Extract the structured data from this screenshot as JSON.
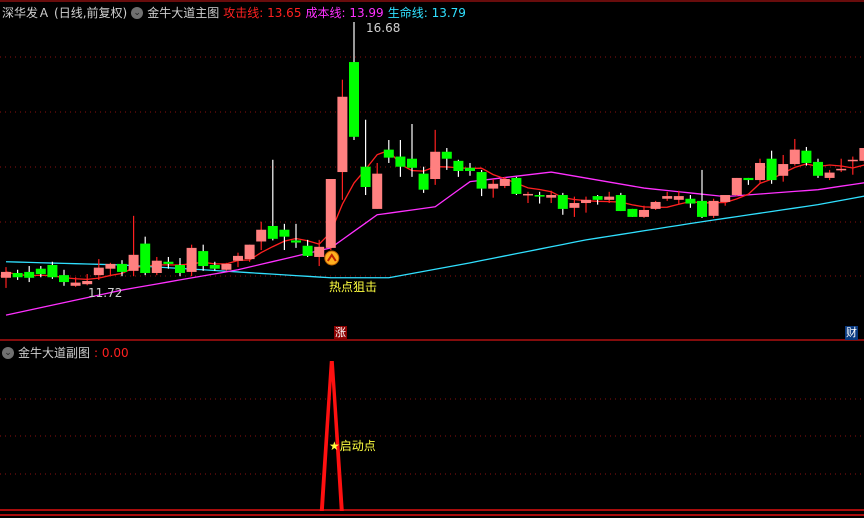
{
  "main_header": {
    "stock": "深华发Ａ",
    "mode": "(日线,前复权)",
    "indicator": "金牛大道主图",
    "attack_label": "攻击线:",
    "attack_value": "13.65",
    "cost_label": "成本线:",
    "cost_value": "13.99",
    "life_label": "生命线:",
    "life_value": "13.79"
  },
  "sub_header": {
    "indicator": "金牛大道副图",
    "value": ": 0.00"
  },
  "annotations": {
    "high_label": "16.68",
    "low_label": "11.72",
    "signal_main": "热点狙击",
    "signal_sub": "启动点",
    "tag_zhang": "涨",
    "tag_cai": "财"
  },
  "colors": {
    "up": "#ff8080",
    "down": "#00ff00",
    "attack": "#ff2020",
    "cost": "#ff30ff",
    "life": "#30e0ff",
    "grid": "#8b1010"
  },
  "chart_data": {
    "type": "candlestick",
    "ylim": [
      11.0,
      16.9
    ],
    "candles": [
      [
        11.89,
        12.09,
        11.7,
        12.0
      ],
      [
        11.98,
        12.04,
        11.85,
        11.9
      ],
      [
        12.0,
        12.11,
        11.81,
        11.89
      ],
      [
        12.06,
        12.11,
        11.9,
        11.96
      ],
      [
        12.13,
        12.19,
        11.87,
        11.9
      ],
      [
        11.94,
        12.04,
        11.74,
        11.81
      ],
      [
        11.74,
        11.9,
        11.72,
        11.8
      ],
      [
        11.77,
        11.96,
        11.75,
        11.83
      ],
      [
        11.94,
        12.24,
        11.85,
        12.08
      ],
      [
        12.06,
        12.17,
        11.92,
        12.15
      ],
      [
        12.15,
        12.22,
        11.92,
        12.0
      ],
      [
        12.02,
        13.05,
        11.92,
        12.32
      ],
      [
        12.53,
        12.66,
        11.94,
        11.98
      ],
      [
        11.98,
        12.28,
        11.94,
        12.21
      ],
      [
        12.19,
        12.28,
        12.06,
        12.15
      ],
      [
        12.13,
        12.26,
        11.92,
        11.98
      ],
      [
        12.0,
        12.51,
        11.92,
        12.45
      ],
      [
        12.39,
        12.51,
        12.02,
        12.11
      ],
      [
        12.13,
        12.19,
        12.02,
        12.06
      ],
      [
        12.04,
        12.17,
        12.02,
        12.15
      ],
      [
        12.21,
        12.36,
        12.09,
        12.3
      ],
      [
        12.24,
        12.51,
        12.19,
        12.51
      ],
      [
        12.57,
        12.94,
        12.41,
        12.79
      ],
      [
        12.86,
        14.1,
        12.59,
        12.62
      ],
      [
        12.79,
        12.9,
        12.41,
        12.66
      ],
      [
        12.59,
        12.9,
        12.45,
        12.55
      ],
      [
        12.49,
        12.6,
        12.28,
        12.3
      ],
      [
        12.28,
        12.6,
        12.11,
        12.47
      ],
      [
        12.45,
        13.74,
        12.41,
        13.74
      ],
      [
        13.87,
        15.6,
        13.35,
        15.28
      ],
      [
        15.93,
        16.68,
        14.47,
        14.53
      ],
      [
        13.97,
        14.85,
        13.44,
        13.59
      ],
      [
        13.18,
        14.04,
        13.18,
        13.84
      ],
      [
        14.29,
        14.47,
        14.04,
        14.14
      ],
      [
        14.16,
        14.47,
        13.78,
        13.97
      ],
      [
        14.12,
        14.77,
        13.78,
        13.95
      ],
      [
        13.84,
        13.97,
        13.48,
        13.54
      ],
      [
        13.74,
        14.66,
        13.63,
        14.25
      ],
      [
        14.25,
        14.32,
        13.91,
        14.12
      ],
      [
        14.08,
        14.1,
        13.78,
        13.89
      ],
      [
        13.95,
        14.04,
        13.8,
        13.89
      ],
      [
        13.87,
        13.91,
        13.42,
        13.56
      ],
      [
        13.56,
        13.74,
        13.39,
        13.65
      ],
      [
        13.61,
        13.78,
        13.57,
        13.74
      ],
      [
        13.76,
        13.78,
        13.44,
        13.46
      ],
      [
        13.44,
        13.5,
        13.29,
        13.46
      ],
      [
        13.44,
        13.5,
        13.28,
        13.41
      ],
      [
        13.39,
        13.52,
        13.29,
        13.44
      ],
      [
        13.44,
        13.48,
        13.07,
        13.18
      ],
      [
        13.2,
        13.41,
        13.03,
        13.29
      ],
      [
        13.29,
        13.41,
        13.11,
        13.35
      ],
      [
        13.42,
        13.44,
        13.26,
        13.35
      ],
      [
        13.35,
        13.5,
        13.29,
        13.41
      ],
      [
        13.44,
        13.48,
        13.14,
        13.14
      ],
      [
        13.18,
        13.18,
        13.03,
        13.03
      ],
      [
        13.03,
        13.24,
        13.01,
        13.16
      ],
      [
        13.18,
        13.33,
        13.16,
        13.31
      ],
      [
        13.37,
        13.5,
        13.33,
        13.42
      ],
      [
        13.35,
        13.52,
        13.26,
        13.42
      ],
      [
        13.37,
        13.44,
        13.2,
        13.28
      ],
      [
        13.33,
        13.91,
        13.01,
        13.03
      ],
      [
        13.05,
        13.37,
        13.01,
        13.33
      ],
      [
        13.31,
        13.44,
        13.24,
        13.44
      ],
      [
        13.44,
        13.76,
        13.42,
        13.76
      ],
      [
        13.76,
        13.76,
        13.63,
        13.72
      ],
      [
        13.72,
        14.12,
        13.67,
        14.04
      ],
      [
        14.12,
        14.27,
        13.65,
        13.72
      ],
      [
        13.8,
        14.19,
        13.69,
        14.02
      ],
      [
        14.02,
        14.49,
        13.99,
        14.29
      ],
      [
        14.27,
        14.34,
        13.99,
        14.04
      ],
      [
        14.06,
        14.12,
        13.76,
        13.8
      ],
      [
        13.76,
        13.91,
        13.72,
        13.86
      ],
      [
        13.91,
        14.12,
        13.87,
        13.93
      ],
      [
        14.08,
        14.16,
        13.82,
        14.1
      ],
      [
        14.08,
        14.32,
        14.04,
        14.32
      ]
    ],
    "cost_line_keypoints": [
      [
        0,
        11.19
      ],
      [
        10,
        11.66
      ],
      [
        20,
        12.04
      ],
      [
        28,
        12.45
      ],
      [
        32,
        13.07
      ],
      [
        37,
        13.22
      ],
      [
        40,
        13.69
      ],
      [
        47,
        13.87
      ],
      [
        55,
        13.57
      ],
      [
        62,
        13.41
      ],
      [
        70,
        13.54
      ],
      [
        74,
        13.67
      ]
    ],
    "life_line_keypoints": [
      [
        0,
        12.19
      ],
      [
        10,
        12.13
      ],
      [
        17,
        12.04
      ],
      [
        28,
        11.89
      ],
      [
        33,
        11.89
      ],
      [
        40,
        12.17
      ],
      [
        50,
        12.6
      ],
      [
        60,
        12.94
      ],
      [
        70,
        13.26
      ],
      [
        74,
        13.42
      ]
    ],
    "attack_period": 5,
    "signal_index": 28,
    "sub_series": {
      "signal_index": 28,
      "peak": 1,
      "ylim": [
        0,
        1
      ]
    }
  }
}
